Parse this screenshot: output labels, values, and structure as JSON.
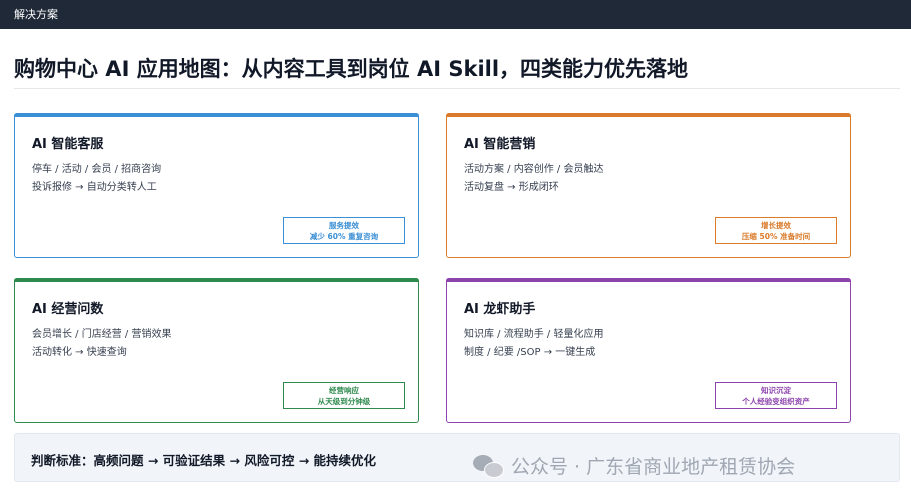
{
  "header": {
    "label": "解决方案"
  },
  "title": "购物中心 AI 应用地图：从内容工具到岗位 AI Skill，四类能力优先落地",
  "cards": [
    {
      "title": "AI 智能客服",
      "lines": [
        "停车 / 活动 / 会员 / 招商咨询",
        "投诉报修 → 自动分类转人工"
      ],
      "badge": {
        "line1": "服务提效",
        "line2": "减少 60% 重复咨询"
      },
      "color": "#3b8fd4"
    },
    {
      "title": "AI 智能营销",
      "lines": [
        "活动方案 / 内容创作 / 会员触达",
        "活动复盘 → 形成闭环"
      ],
      "badge": {
        "line1": "增长提效",
        "line2": "压缩 50% 准备时间"
      },
      "color": "#d97b2b"
    },
    {
      "title": "AI 经营问数",
      "lines": [
        "会员增长 / 门店经营 / 营销效果",
        "活动转化 → 快速查询"
      ],
      "badge": {
        "line1": "经营响应",
        "line2": "从天级到分钟级"
      },
      "color": "#2f8a4e"
    },
    {
      "title": "AI 龙虾助手",
      "lines": [
        "知识库 / 流程助手 / 轻量化应用",
        "制度 / 纪要 /SOP → 一键生成"
      ],
      "badge": {
        "line1": "知识沉淀",
        "line2": "个人经验变组织资产"
      },
      "color": "#8e44ad"
    }
  ],
  "footer": {
    "criteria": "判断标准：高频问题 → 可验证结果 → 风险可控 → 能持续优化"
  },
  "watermark": {
    "text": "公众号 · 广东省商业地产租赁协会",
    "icon": "wechat-icon"
  }
}
